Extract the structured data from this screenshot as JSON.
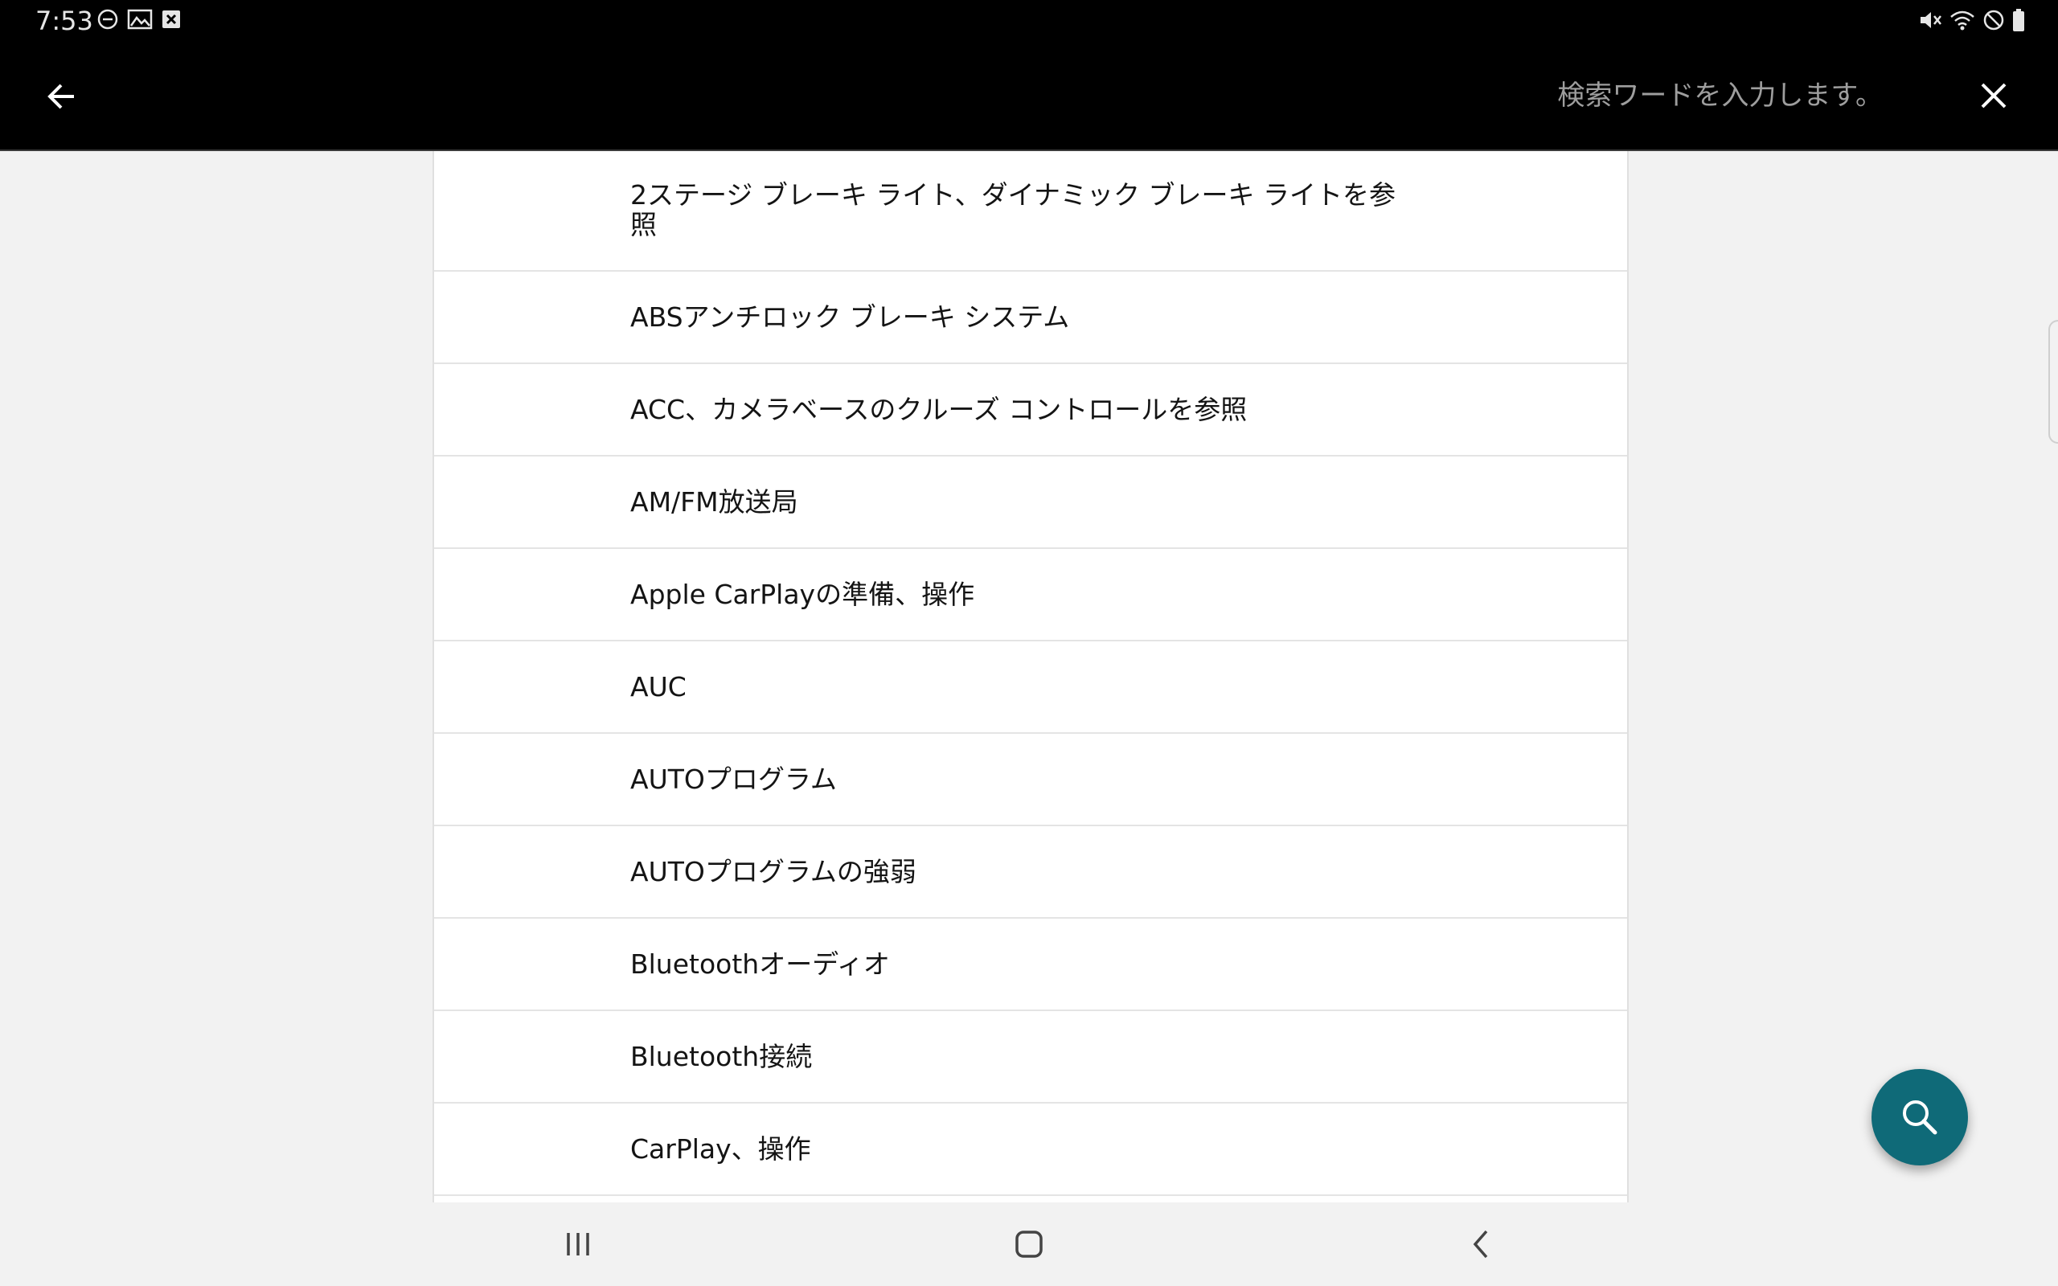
{
  "status_bar": {
    "time": "7:53",
    "left_icons": [
      "dnd-icon",
      "gallery-icon",
      "close-box-icon"
    ],
    "right_icons": [
      "mute-icon",
      "wifi-icon",
      "blocked-icon",
      "battery-icon"
    ]
  },
  "header": {
    "search_placeholder": "検索ワードを入力します。",
    "back_icon": "arrow-left-icon",
    "close_icon": "close-icon"
  },
  "index_items": [
    {
      "label": "2ステージ ブレーキ ライト、ダイナミック ブレーキ ライトを参照"
    },
    {
      "label": "ABSアンチロック ブレーキ システム"
    },
    {
      "label": "ACC、カメラベースのクルーズ コントロールを参照"
    },
    {
      "label": "AM/FM放送局"
    },
    {
      "label": "Apple CarPlayの準備、操作"
    },
    {
      "label": "AUC"
    },
    {
      "label": "AUTOプログラム"
    },
    {
      "label": "AUTOプログラムの強弱"
    },
    {
      "label": "Bluetoothオーディオ"
    },
    {
      "label": "Bluetooth接続"
    },
    {
      "label": "CarPlay、操作"
    }
  ],
  "fab": {
    "icon": "search-icon",
    "color": "#0f6a78"
  },
  "nav_bar": {
    "icons": [
      "recent-apps-icon",
      "home-icon",
      "back-chevron-icon"
    ]
  }
}
